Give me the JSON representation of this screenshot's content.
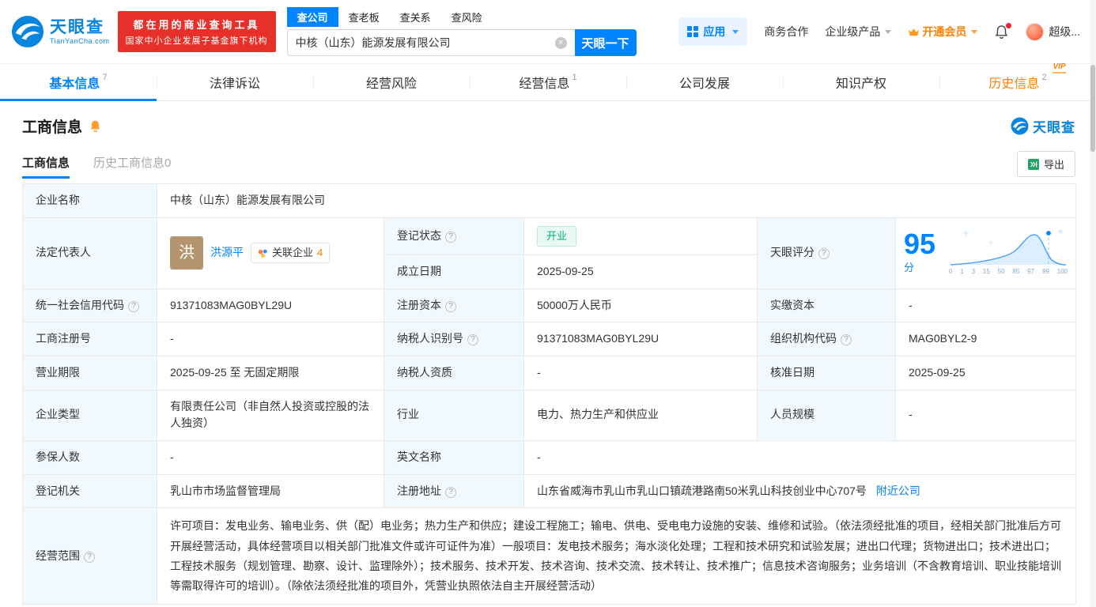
{
  "colors": {
    "accent_blue": "#0084ff",
    "logo_blue": "#0a85dd",
    "promo_red": "#e8302a",
    "vip_orange": "#ff8000",
    "status_green": "#00b173",
    "label_cell_bg": "#f2f9fe"
  },
  "brand": {
    "logo_title": "天眼查",
    "logo_domain": "TianYanCha.com",
    "slogan1": "都在用的商业查询工具",
    "slogan2": "国家中小企业发展子基金旗下机构"
  },
  "search": {
    "tabs": [
      {
        "label": "查公司"
      },
      {
        "label": "查老板"
      },
      {
        "label": "查关系"
      },
      {
        "label": "查风险"
      }
    ],
    "value": "中核（山东）能源发展有限公司",
    "button": "天眼一下"
  },
  "nav": {
    "apps": "应用",
    "cooperation": "商务合作",
    "enterprise": "企业级产品",
    "vip": "开通会员",
    "user": "超级..."
  },
  "tabs": [
    {
      "label": "基本信息",
      "badge": "7"
    },
    {
      "label": "法律诉讼",
      "badge": ""
    },
    {
      "label": "经营风险",
      "badge": ""
    },
    {
      "label": "经营信息",
      "badge": "1"
    },
    {
      "label": "公司发展",
      "badge": ""
    },
    {
      "label": "知识产权",
      "badge": ""
    },
    {
      "label": "历史信息",
      "badge": "2",
      "vip": "VIP"
    }
  ],
  "section": {
    "title": "工商信息",
    "watermark": "天眼查",
    "subtab_active": "工商信息",
    "subtab_history": "历史工商信息0",
    "export": "导出"
  },
  "rep": {
    "avatar": "洪",
    "name": "洪源平",
    "related": "关联企业",
    "count": "4"
  },
  "score": {
    "value": "95",
    "unit": "分",
    "axis": [
      "0",
      "1",
      "3",
      "15",
      "50",
      "85",
      "97",
      "99",
      "100"
    ]
  },
  "t": {
    "labels": {
      "name": "企业名称",
      "legal_rep": "法定代表人",
      "reg_status": "登记状态",
      "establish_date": "成立日期",
      "score": "天眼评分",
      "credit_code": "统一社会信用代码",
      "reg_capital": "注册资本",
      "paid_capital": "实缴资本",
      "reg_no": "工商注册号",
      "taxpayer_id": "纳税人识别号",
      "org_code": "组织机构代码",
      "term": "营业期限",
      "taxpayer_quality": "纳税人资质",
      "approval_date": "核准日期",
      "type": "企业类型",
      "industry": "行业",
      "staff": "人员规模",
      "insured": "参保人数",
      "english": "英文名称",
      "authority": "登记机关",
      "address": "注册地址",
      "scope": "经营范围"
    },
    "values": {
      "name": "中核（山东）能源发展有限公司",
      "reg_status": "开业",
      "establish_date": "2025-09-25",
      "credit_code": "91371083MAG0BYL29U",
      "reg_capital": "50000万人民币",
      "paid_capital": "-",
      "reg_no": "-",
      "taxpayer_id": "91371083MAG0BYL29U",
      "org_code": "MAG0BYL2-9",
      "term": "2025-09-25 至 无固定期限",
      "taxpayer_quality": "-",
      "approval_date": "2025-09-25",
      "type": "有限责任公司（非自然人投资或控股的法人独资）",
      "industry": "电力、热力生产和供应业",
      "staff": "-",
      "insured": "-",
      "english": "-",
      "authority": "乳山市市场监督管理局",
      "address": "山东省威海市乳山市乳山口镇疏港路南50米乳山科技创业中心707号",
      "nearby": "附近公司",
      "scope": "许可项目：发电业务、输电业务、供（配）电业务；热力生产和供应；建设工程施工；输电、供电、受电电力设施的安装、维修和试验。（依法须经批准的项目，经相关部门批准后方可开展经营活动，具体经营项目以相关部门批准文件或许可证件为准）一般项目：发电技术服务；海水淡化处理；工程和技术研究和试验发展；进出口代理；货物进出口；技术进出口；工程技术服务（规划管理、勘察、设计、监理除外）；技术服务、技术开发、技术咨询、技术交流、技术转让、技术推广；信息技术咨询服务；业务培训（不含教育培训、职业技能培训等需取得许可的培训）。（除依法须经批准的项目外，凭营业执照依法自主开展经营活动）"
    }
  }
}
